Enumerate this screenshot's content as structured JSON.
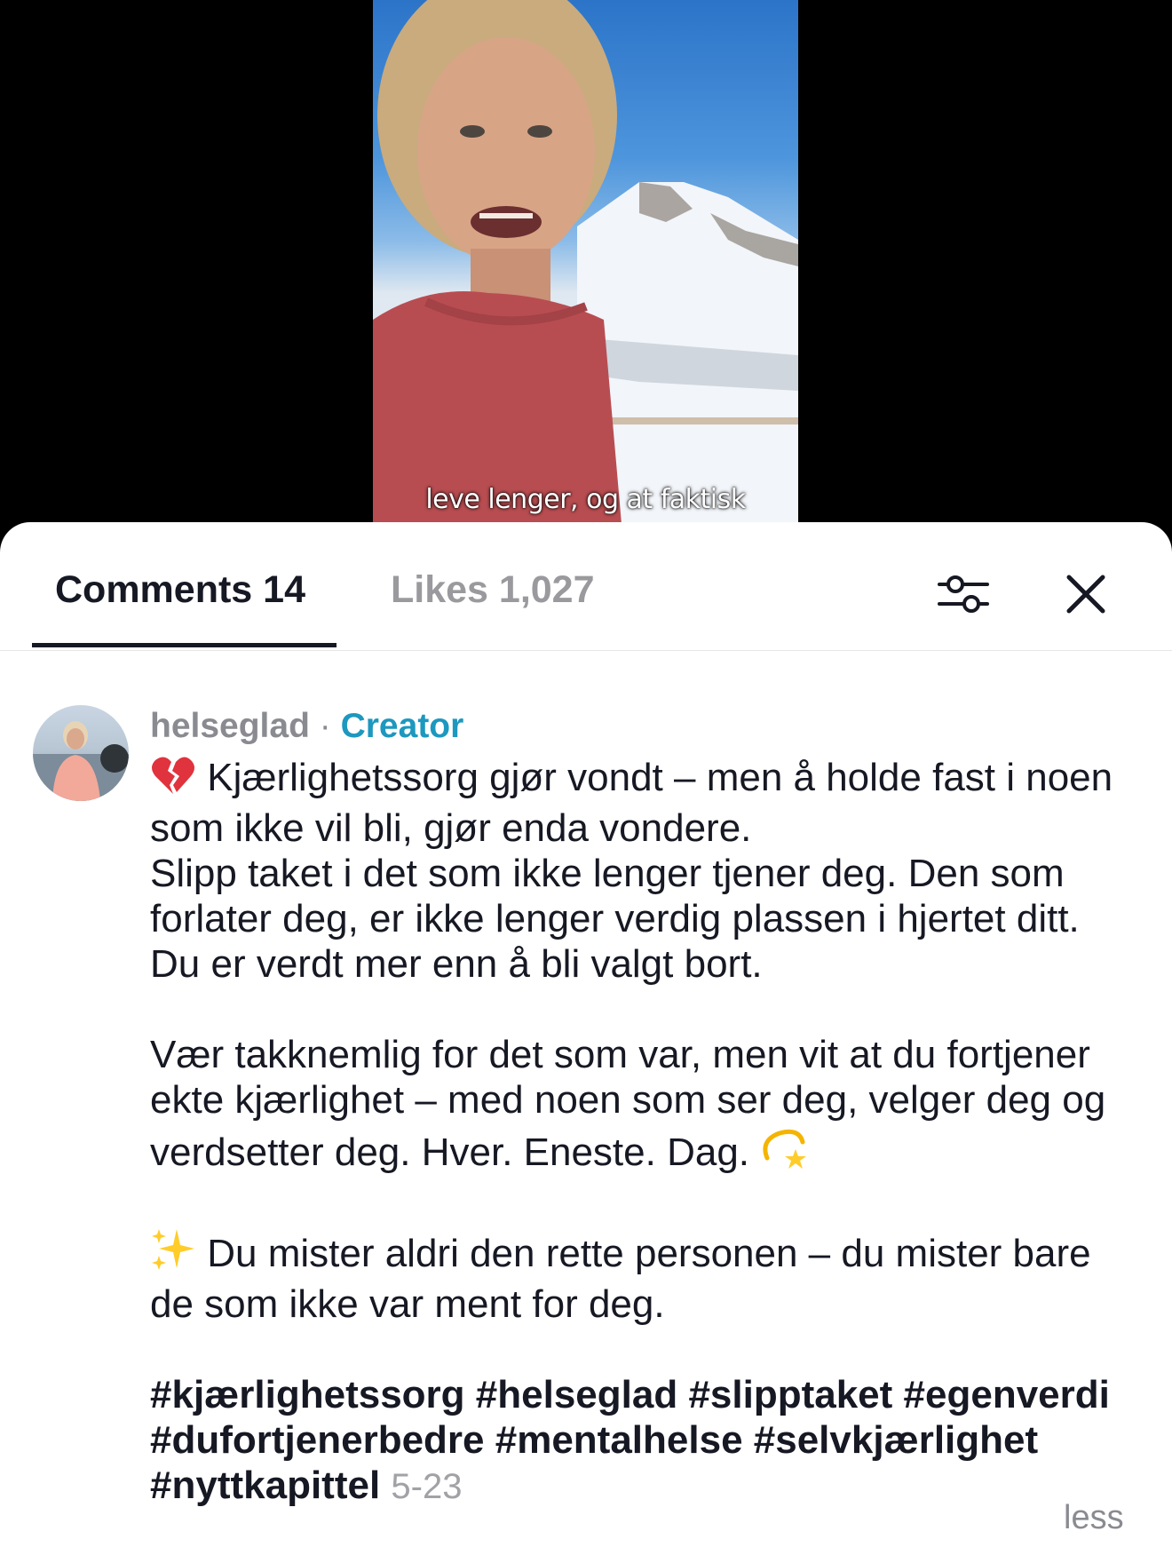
{
  "video": {
    "subtitle": "leve lenger, og at faktisk"
  },
  "tabs": {
    "comments_label": "Comments 14",
    "likes_label": "Likes 1,027"
  },
  "toolbar": {
    "filter_icon": "sliders-icon",
    "close_icon": "close-icon"
  },
  "comment": {
    "username": "helseglad",
    "separator": "·",
    "badge": "Creator",
    "paragraphs": [
      "Kjærlighetssorg gjør vondt – men å holde fast i noen som ikke vil bli, gjør enda vondere.\nSlipp taket i det som ikke lenger tjener deg. Den som forlater deg, er ikke lenger verdig plassen i hjertet ditt. Du er verdt mer enn å bli valgt bort.",
      "Vær takknemlig for det som var, men vit at du fortjener ekte kjærlighet – med noen som ser deg, velger deg og verdsetter deg. Hver. Eneste. Dag.",
      "Du mister aldri den rette personen – du mister bare de som ikke var ment for deg."
    ],
    "hashtags": "#kjærlighetssorg #helseglad #slipptaket #egenverdi #dufortjenerbedre #mentalhelse #selvkjærlighet #nyttkapittel",
    "date": "5-23",
    "less_label": "less",
    "icons": [
      "broken-heart-icon",
      "dizzy-star-icon",
      "sparkles-icon"
    ]
  },
  "colors": {
    "creator": "#1d98bf",
    "text": "#161823",
    "muted": "#8a8b91"
  }
}
